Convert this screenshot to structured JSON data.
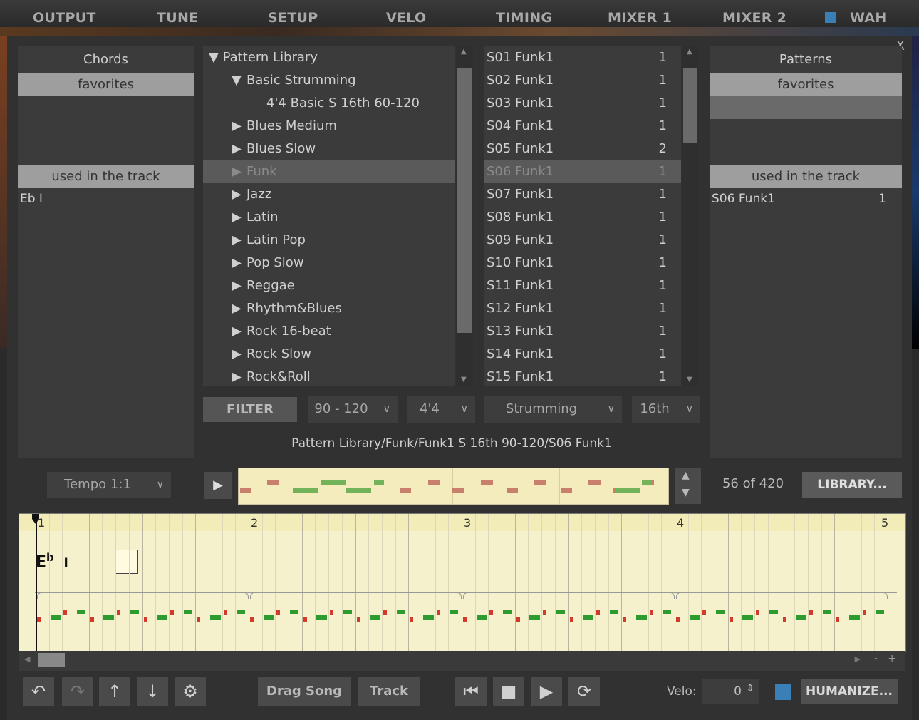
{
  "top_tabs": [
    "OUTPUT",
    "TUNE",
    "SETUP",
    "VELO",
    "TIMING",
    "MIXER 1",
    "MIXER 2",
    "WAH"
  ],
  "close_label": "X",
  "chords": {
    "title": "Chords",
    "favorites": "favorites",
    "used_label": "used in the track",
    "used_items": [
      "Eb I"
    ]
  },
  "patterns_panel": {
    "title": "Patterns",
    "favorites": "favorites",
    "used_label": "used in the track",
    "used_items": [
      {
        "name": "S06 Funk1",
        "count": "1"
      }
    ]
  },
  "tree": {
    "root": "Pattern Library",
    "items": [
      {
        "label": "Basic Strumming",
        "arrow": "▼",
        "level": 1
      },
      {
        "label": "4'4 Basic S 16th 60-120",
        "arrow": "",
        "level": 2
      },
      {
        "label": "Blues Medium",
        "arrow": "▶",
        "level": 1
      },
      {
        "label": "Blues Slow",
        "arrow": "▶",
        "level": 1
      },
      {
        "label": "Funk",
        "arrow": "▶",
        "level": 1,
        "selected": true
      },
      {
        "label": "Jazz",
        "arrow": "▶",
        "level": 1
      },
      {
        "label": "Latin",
        "arrow": "▶",
        "level": 1
      },
      {
        "label": "Latin Pop",
        "arrow": "▶",
        "level": 1
      },
      {
        "label": "Pop Slow",
        "arrow": "▶",
        "level": 1
      },
      {
        "label": "Reggae",
        "arrow": "▶",
        "level": 1
      },
      {
        "label": "Rhythm&Blues",
        "arrow": "▶",
        "level": 1
      },
      {
        "label": "Rock 16-beat",
        "arrow": "▶",
        "level": 1
      },
      {
        "label": "Rock Slow",
        "arrow": "▶",
        "level": 1
      },
      {
        "label": "Rock&Roll",
        "arrow": "▶",
        "level": 1
      }
    ]
  },
  "pattern_list": [
    {
      "name": "S01 Funk1",
      "count": "1"
    },
    {
      "name": "S02 Funk1",
      "count": "1"
    },
    {
      "name": "S03 Funk1",
      "count": "1"
    },
    {
      "name": "S04 Funk1",
      "count": "1"
    },
    {
      "name": "S05 Funk1",
      "count": "2"
    },
    {
      "name": "S06 Funk1",
      "count": "1",
      "selected": true
    },
    {
      "name": "S07 Funk1",
      "count": "1"
    },
    {
      "name": "S08 Funk1",
      "count": "1"
    },
    {
      "name": "S09 Funk1",
      "count": "1"
    },
    {
      "name": "S10 Funk1",
      "count": "1"
    },
    {
      "name": "S11 Funk1",
      "count": "1"
    },
    {
      "name": "S12 Funk1",
      "count": "1"
    },
    {
      "name": "S13 Funk1",
      "count": "1"
    },
    {
      "name": "S14 Funk1",
      "count": "1"
    },
    {
      "name": "S15 Funk1",
      "count": "1"
    }
  ],
  "filters": {
    "filter_label": "FILTER",
    "tempo": "90 - 120",
    "meter": "4'4",
    "style": "Strumming",
    "resolution": "16th"
  },
  "path": "Pattern Library/Funk/Funk1 S 16th 90-120/S06 Funk1",
  "tempo_select": "Tempo 1:1",
  "pattern_count": "56 of 420",
  "library_button": "LIBRARY...",
  "timeline": {
    "bars": [
      "1",
      "2",
      "3",
      "4",
      "5"
    ],
    "chord_root": "E",
    "chord_accidental": "b",
    "chord_degree": "I"
  },
  "bottom": {
    "drag_song": "Drag Song",
    "track": "Track",
    "velo_label": "Velo:",
    "velo_value": "0",
    "humanize": "HUMANIZE..."
  },
  "colors": {
    "accent": "#3a7fb5",
    "selected_row": "#5a5a5a",
    "favorites_bar": "#9e9e9e"
  }
}
